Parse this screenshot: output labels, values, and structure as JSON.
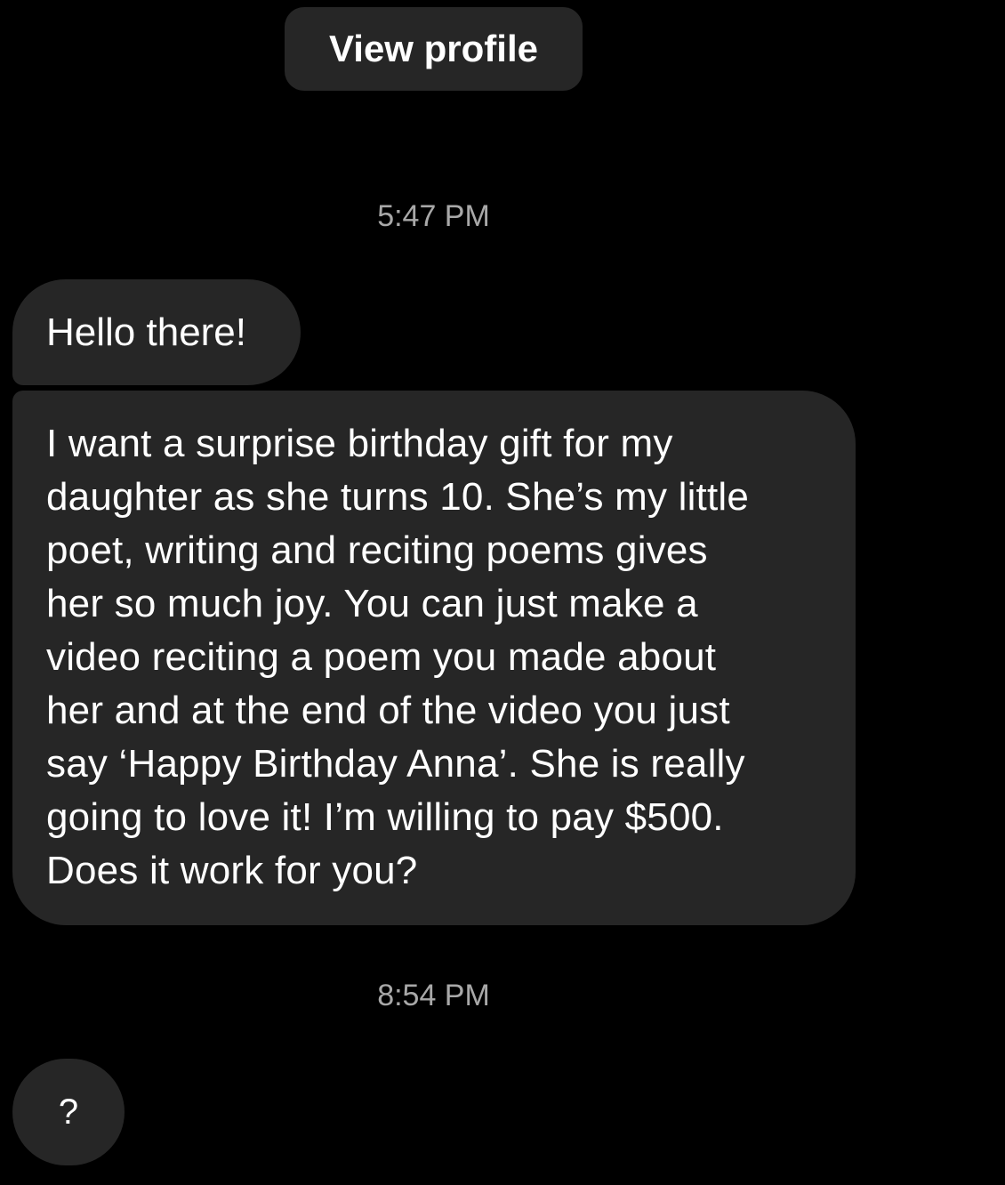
{
  "header": {
    "view_profile_label": "View profile"
  },
  "thread": {
    "timestamps": [
      "5:47 PM",
      "8:54 PM"
    ],
    "messages": [
      {
        "text": "Hello there!"
      },
      {
        "lines": [
          "I want a surprise birthday gift for my",
          "daughter as she turns 10. She’s my little",
          "poet, writing and reciting poems gives",
          "her so much joy. You can just make a",
          "video reciting a poem you made about",
          "her and at the end of the video you just",
          "say ‘Happy Birthday Anna’. She is really",
          "going to love it! I’m willing to pay $500.",
          "Does it work for you?"
        ]
      },
      {
        "text": "?"
      }
    ]
  },
  "colors": {
    "background": "#000000",
    "bubble": "#262626",
    "text": "#ffffff",
    "timestamp": "#a8a8a8"
  }
}
